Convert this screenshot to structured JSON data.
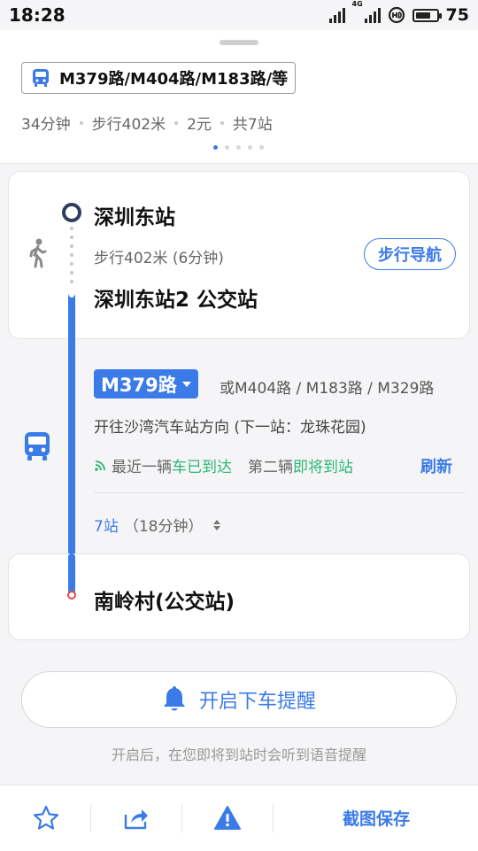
{
  "status_bar": {
    "time": "18:28",
    "network_label": "4G",
    "battery": "75",
    "battery_level": 0.75
  },
  "header": {
    "route_summary": "M379路/M404路/M183路/等",
    "duration": "34分钟",
    "walk": "步行402米",
    "fare": "2元",
    "stops": "共7站",
    "pager_count": 5,
    "pager_active": 0
  },
  "walk_section": {
    "start_name": "深圳东站",
    "walk_detail": "步行402米 (6分钟)",
    "nav_button": "步行导航",
    "board_stop": "深圳东站2 公交站"
  },
  "bus_section": {
    "route_name": "M379路",
    "alt_routes": "或M404路 / M183路 / M329路",
    "direction": "开往沙湾汽车站方向 (下一站：龙珠花园)",
    "first_bus_label": "最近一辆",
    "first_bus_status": "车已到达",
    "second_bus_label": "第二辆",
    "second_bus_status": "即将到站",
    "refresh": "刷新",
    "stops_count": "7站",
    "stops_time": "（18分钟）"
  },
  "destination": {
    "name": "南岭村(公交站)"
  },
  "reminder": {
    "button": "开启下车提醒",
    "note": "开启后，在您即将到站时会听到语音提醒"
  },
  "toolbar": {
    "save": "截图保存"
  },
  "colors": {
    "accent": "#3b7be8",
    "green": "#2cb676",
    "end_red": "#e24a4a",
    "start_dark": "#2d3e5c"
  }
}
